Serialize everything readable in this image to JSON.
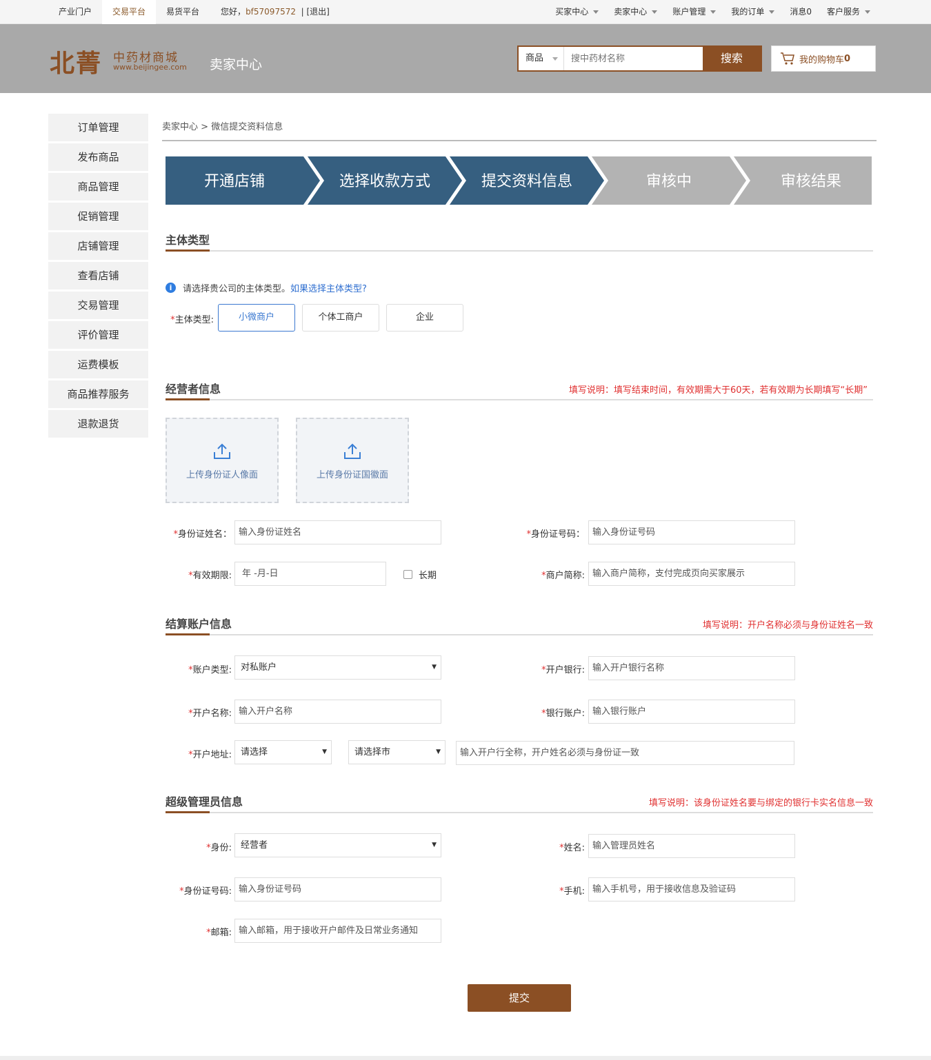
{
  "topbar": {
    "tabs": [
      "产业门户",
      "交易平台",
      "易货平台"
    ],
    "greeting_prefix": "您好，",
    "username": "bf57097572",
    "logout": "|  [退出]",
    "menus": [
      "买家中心",
      "卖家中心",
      "账户管理",
      "我的订单",
      "消息0",
      "客户服务"
    ]
  },
  "header": {
    "logo_main": "北菁",
    "logo_cn": "中药材商城",
    "logo_en": "www.beijingee.com",
    "center_title": "卖家中心",
    "search_scope": "商品",
    "search_placeholder": "搜中药材名称",
    "search_button": "搜索",
    "cart_label": "我的购物车",
    "cart_count": "0"
  },
  "sidebar": {
    "items": [
      "订单管理",
      "发布商品",
      "商品管理",
      "促销管理",
      "店铺管理",
      "查看店铺",
      "交易管理",
      "评价管理",
      "运费模板",
      "商品推荐服务",
      "退款退货"
    ]
  },
  "breadcrumb": {
    "root": "卖家中心",
    "sep": ">",
    "current": "微信提交资料信息"
  },
  "steps": {
    "items": [
      "开通店铺",
      "选择收款方式",
      "提交资料信息",
      "审核中",
      "审核结果"
    ],
    "active_count": 3,
    "colors": {
      "active": "#365f80",
      "inactive": "#b3b3b3"
    }
  },
  "subject": {
    "title": "主体类型",
    "info_text": "请选择贵公司的主体类型。",
    "info_link": "如果选择主体类型?",
    "label": "主体类型:",
    "options": [
      "小微商户",
      "个体工商户",
      "企业"
    ],
    "selected": "小微商户"
  },
  "operator": {
    "title": "经营者信息",
    "note": "填写说明：填写结束时间，有效期需大于60天，若有效期为长期填写“长期”",
    "upload_front": "上传身份证人像面",
    "upload_back": "上传身份证国徽面",
    "name_label": "身份证姓名：",
    "name_placeholder": "输入身份证姓名",
    "id_label": "身份证号码：",
    "id_placeholder": "输入身份证号码",
    "validity_label": "有效期限:",
    "validity_placeholder": "年 -月-日",
    "longterm_label": "长期",
    "merchant_label": "商户简称:",
    "merchant_placeholder": "输入商户简称，支付完成页向买家展示"
  },
  "settlement": {
    "title": "结算账户信息",
    "note": "填写说明：开户名称必须与身份证姓名一致",
    "account_type_label": "账户类型:",
    "account_type_value": "对私账户",
    "bank_label": "开户银行:",
    "bank_placeholder": "输入开户银行名称",
    "account_name_label": "开户名称:",
    "account_name_placeholder": "输入开户名称",
    "bank_account_label": "银行账户:",
    "bank_account_placeholder": "输入银行账户",
    "address_label": "开户地址:",
    "province_value": "请选择",
    "city_value": "请选择市",
    "branch_placeholder": "输入开户行全称，开户姓名必须与身份证一致"
  },
  "admin": {
    "title": "超级管理员信息",
    "note": "填写说明：该身份证姓名要与绑定的银行卡实名信息一致",
    "role_label": "身份:",
    "role_value": "经营者",
    "name_label": "姓名:",
    "name_placeholder": "输入管理员姓名",
    "id_label": "身份证号码:",
    "id_placeholder": "输入身份证号码",
    "phone_label": "手机:",
    "phone_placeholder": "输入手机号，用于接收信息及验证码",
    "email_label": "邮箱:",
    "email_placeholder": "输入邮箱，用于接收开户邮件及日常业务通知"
  },
  "submit_label": "提交",
  "required_mark": "*"
}
